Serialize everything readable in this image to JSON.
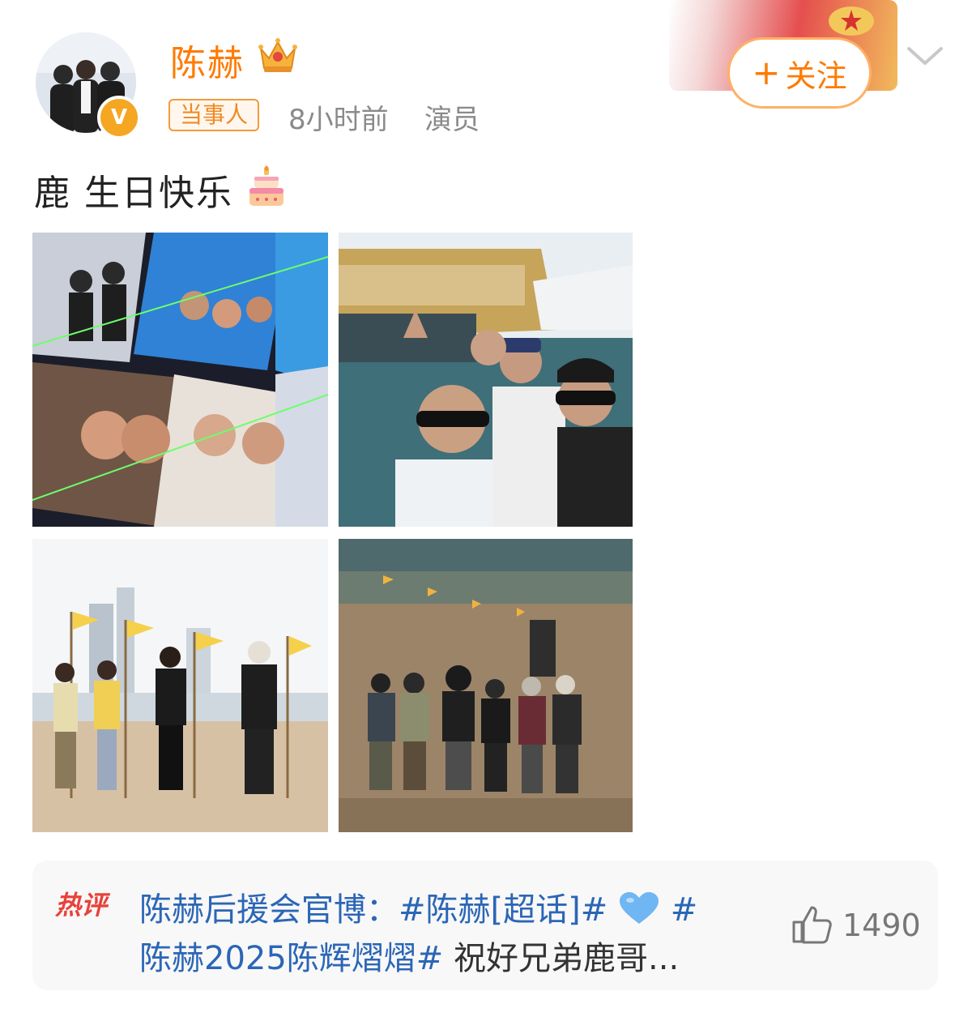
{
  "post": {
    "username": "陈赫",
    "tag": "当事人",
    "time": "8小时前",
    "role": "演员",
    "follow_label": "关注",
    "follow_plus": "+",
    "text": "鹿 生日快乐",
    "icons": {
      "crown": "crown-icon",
      "cake": "cake-icon",
      "verified": "verified-badge",
      "more": "chevron-down-icon"
    },
    "accent_color": "#ff7a00"
  },
  "verified_mark": "V",
  "photos": [
    {
      "name": "photo-collage-cards"
    },
    {
      "name": "photo-group-selfie-boat"
    },
    {
      "name": "photo-beach-flags-group"
    },
    {
      "name": "photo-beach-walking-group"
    }
  ],
  "hot_comment": {
    "label": "热评",
    "line1_text": "陈赫后援会官博：#陈赫[超话]#",
    "line1_tail": "#",
    "line2_topic": "陈赫2025陈辉熠熠#",
    "line2_text": "祝好兄弟鹿哥...",
    "likes": "1490",
    "link_color": "#2b66b6"
  }
}
